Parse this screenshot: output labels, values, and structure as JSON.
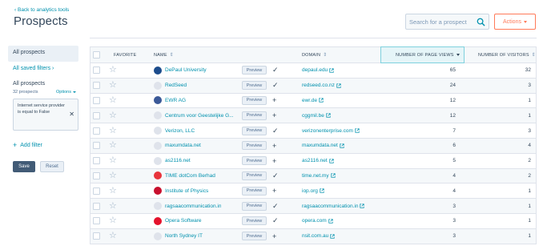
{
  "header": {
    "back_link": "Back to analytics tools",
    "title": "Prospects",
    "search_placeholder": "Search for a prospect",
    "actions_label": "Actions"
  },
  "sidebar": {
    "all_prospects": "All prospects",
    "all_saved_filters": "All saved filters",
    "section_title": "All prospects",
    "count": "32 prospects",
    "options_label": "Options",
    "filter_text": "Internet service provider is equal to False",
    "add_filter": "Add filter",
    "save_label": "Save",
    "reset_label": "Reset"
  },
  "table": {
    "columns": {
      "favorite": "FAVORITE",
      "name": "NAME",
      "domain": "DOMAIN",
      "page_views": "NUMBER OF PAGE VIEWS",
      "visitors": "NUMBER OF VISITORS"
    },
    "preview_label": "Preview",
    "rows": [
      {
        "name": "DePaul University",
        "domain": "depaul.edu",
        "views": "65",
        "visitors": "32",
        "action": "check",
        "logo": "#1c4c8c"
      },
      {
        "name": "RedSeed",
        "domain": "redseed.co.nz",
        "views": "24",
        "visitors": "3",
        "action": "check",
        "logo": "#dfe3eb"
      },
      {
        "name": "EWR AG",
        "domain": "ewr.de",
        "views": "12",
        "visitors": "1",
        "action": "plus",
        "logo": "#3b5998"
      },
      {
        "name": "Centrum voor Geestelijke G...",
        "domain": "cggmil.be",
        "views": "12",
        "visitors": "1",
        "action": "plus",
        "logo": "#dfe3eb"
      },
      {
        "name": "Verizon, LLC",
        "domain": "verizonenterprise.com",
        "views": "7",
        "visitors": "3",
        "action": "check",
        "logo": "#dfe3eb"
      },
      {
        "name": "maxumdata.net",
        "domain": "maxumdata.net",
        "views": "6",
        "visitors": "4",
        "action": "plus",
        "logo": "#dfe3eb"
      },
      {
        "name": "as2116.net",
        "domain": "as2116.net",
        "views": "5",
        "visitors": "2",
        "action": "plus",
        "logo": "#dfe3eb"
      },
      {
        "name": "TIME dotCom Berhad",
        "domain": "time.net.my",
        "views": "4",
        "visitors": "2",
        "action": "check",
        "logo": "#e8343c"
      },
      {
        "name": "Institute of Physics",
        "domain": "iop.org",
        "views": "4",
        "visitors": "1",
        "action": "plus",
        "logo": "#c8102e"
      },
      {
        "name": "ragsaacommunication.in",
        "domain": "ragsaacommunication.in",
        "views": "3",
        "visitors": "1",
        "action": "check",
        "logo": "#dfe3eb"
      },
      {
        "name": "Opera Software",
        "domain": "opera.com",
        "views": "3",
        "visitors": "1",
        "action": "check",
        "logo": "#e4122c"
      },
      {
        "name": "North Sydney IT",
        "domain": "nsit.com.au",
        "views": "3",
        "visitors": "1",
        "action": "plus",
        "logo": "#dfe3eb"
      }
    ]
  }
}
